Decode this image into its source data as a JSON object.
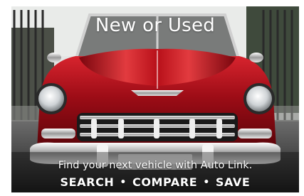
{
  "banner": {
    "headline": "New or Used",
    "tagline": "Find your next vehicle with Auto Link.",
    "actions": [
      "SEARCH",
      "COMPARE",
      "SAVE"
    ],
    "separator": "•",
    "image_subject": "classic-red-convertible-car"
  },
  "colors": {
    "car_red": "#b0101c",
    "chrome": "#d9d9d9",
    "text": "#ffffff"
  }
}
